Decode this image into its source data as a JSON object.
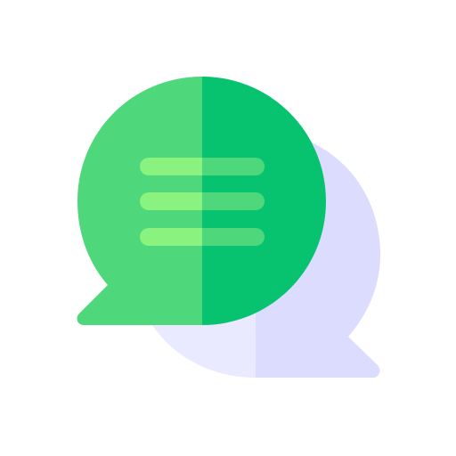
{
  "icon": {
    "name": "chat-bubbles-icon",
    "foreground_bubble": {
      "icon_name": "message-lines-icon",
      "colors": {
        "left": "#4fd87b",
        "right": "#07c36f",
        "line_left": "#8af27f",
        "line_right": "#4fd87b"
      },
      "line_count": 3
    },
    "background_bubble": {
      "icon_name": "chat-bubble-icon",
      "colors": {
        "left": "#e9e9ff",
        "right": "#dcdcff"
      }
    }
  }
}
